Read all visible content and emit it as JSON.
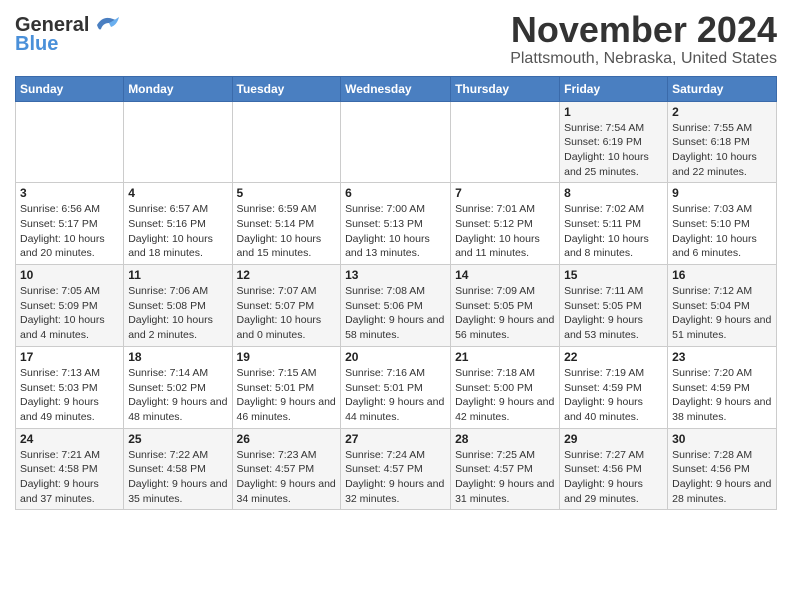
{
  "header": {
    "logo_general": "General",
    "logo_blue": "Blue",
    "month": "November 2024",
    "location": "Plattsmouth, Nebraska, United States"
  },
  "weekdays": [
    "Sunday",
    "Monday",
    "Tuesday",
    "Wednesday",
    "Thursday",
    "Friday",
    "Saturday"
  ],
  "weeks": [
    [
      {
        "day": "",
        "info": ""
      },
      {
        "day": "",
        "info": ""
      },
      {
        "day": "",
        "info": ""
      },
      {
        "day": "",
        "info": ""
      },
      {
        "day": "",
        "info": ""
      },
      {
        "day": "1",
        "info": "Sunrise: 7:54 AM\nSunset: 6:19 PM\nDaylight: 10 hours and 25 minutes."
      },
      {
        "day": "2",
        "info": "Sunrise: 7:55 AM\nSunset: 6:18 PM\nDaylight: 10 hours and 22 minutes."
      }
    ],
    [
      {
        "day": "3",
        "info": "Sunrise: 6:56 AM\nSunset: 5:17 PM\nDaylight: 10 hours and 20 minutes."
      },
      {
        "day": "4",
        "info": "Sunrise: 6:57 AM\nSunset: 5:16 PM\nDaylight: 10 hours and 18 minutes."
      },
      {
        "day": "5",
        "info": "Sunrise: 6:59 AM\nSunset: 5:14 PM\nDaylight: 10 hours and 15 minutes."
      },
      {
        "day": "6",
        "info": "Sunrise: 7:00 AM\nSunset: 5:13 PM\nDaylight: 10 hours and 13 minutes."
      },
      {
        "day": "7",
        "info": "Sunrise: 7:01 AM\nSunset: 5:12 PM\nDaylight: 10 hours and 11 minutes."
      },
      {
        "day": "8",
        "info": "Sunrise: 7:02 AM\nSunset: 5:11 PM\nDaylight: 10 hours and 8 minutes."
      },
      {
        "day": "9",
        "info": "Sunrise: 7:03 AM\nSunset: 5:10 PM\nDaylight: 10 hours and 6 minutes."
      }
    ],
    [
      {
        "day": "10",
        "info": "Sunrise: 7:05 AM\nSunset: 5:09 PM\nDaylight: 10 hours and 4 minutes."
      },
      {
        "day": "11",
        "info": "Sunrise: 7:06 AM\nSunset: 5:08 PM\nDaylight: 10 hours and 2 minutes."
      },
      {
        "day": "12",
        "info": "Sunrise: 7:07 AM\nSunset: 5:07 PM\nDaylight: 10 hours and 0 minutes."
      },
      {
        "day": "13",
        "info": "Sunrise: 7:08 AM\nSunset: 5:06 PM\nDaylight: 9 hours and 58 minutes."
      },
      {
        "day": "14",
        "info": "Sunrise: 7:09 AM\nSunset: 5:05 PM\nDaylight: 9 hours and 56 minutes."
      },
      {
        "day": "15",
        "info": "Sunrise: 7:11 AM\nSunset: 5:05 PM\nDaylight: 9 hours and 53 minutes."
      },
      {
        "day": "16",
        "info": "Sunrise: 7:12 AM\nSunset: 5:04 PM\nDaylight: 9 hours and 51 minutes."
      }
    ],
    [
      {
        "day": "17",
        "info": "Sunrise: 7:13 AM\nSunset: 5:03 PM\nDaylight: 9 hours and 49 minutes."
      },
      {
        "day": "18",
        "info": "Sunrise: 7:14 AM\nSunset: 5:02 PM\nDaylight: 9 hours and 48 minutes."
      },
      {
        "day": "19",
        "info": "Sunrise: 7:15 AM\nSunset: 5:01 PM\nDaylight: 9 hours and 46 minutes."
      },
      {
        "day": "20",
        "info": "Sunrise: 7:16 AM\nSunset: 5:01 PM\nDaylight: 9 hours and 44 minutes."
      },
      {
        "day": "21",
        "info": "Sunrise: 7:18 AM\nSunset: 5:00 PM\nDaylight: 9 hours and 42 minutes."
      },
      {
        "day": "22",
        "info": "Sunrise: 7:19 AM\nSunset: 4:59 PM\nDaylight: 9 hours and 40 minutes."
      },
      {
        "day": "23",
        "info": "Sunrise: 7:20 AM\nSunset: 4:59 PM\nDaylight: 9 hours and 38 minutes."
      }
    ],
    [
      {
        "day": "24",
        "info": "Sunrise: 7:21 AM\nSunset: 4:58 PM\nDaylight: 9 hours and 37 minutes."
      },
      {
        "day": "25",
        "info": "Sunrise: 7:22 AM\nSunset: 4:58 PM\nDaylight: 9 hours and 35 minutes."
      },
      {
        "day": "26",
        "info": "Sunrise: 7:23 AM\nSunset: 4:57 PM\nDaylight: 9 hours and 34 minutes."
      },
      {
        "day": "27",
        "info": "Sunrise: 7:24 AM\nSunset: 4:57 PM\nDaylight: 9 hours and 32 minutes."
      },
      {
        "day": "28",
        "info": "Sunrise: 7:25 AM\nSunset: 4:57 PM\nDaylight: 9 hours and 31 minutes."
      },
      {
        "day": "29",
        "info": "Sunrise: 7:27 AM\nSunset: 4:56 PM\nDaylight: 9 hours and 29 minutes."
      },
      {
        "day": "30",
        "info": "Sunrise: 7:28 AM\nSunset: 4:56 PM\nDaylight: 9 hours and 28 minutes."
      }
    ]
  ]
}
